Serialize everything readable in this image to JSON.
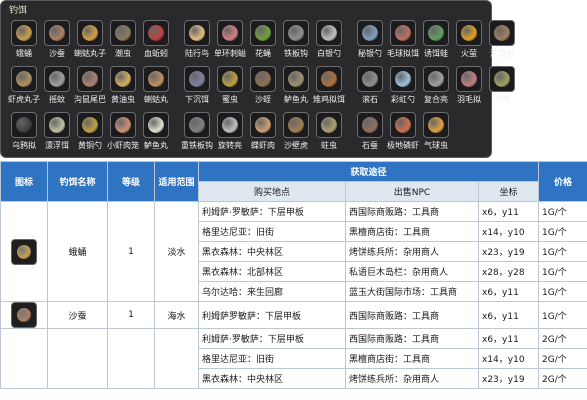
{
  "panel": {
    "title": "钓饵",
    "rows": [
      [
        {
          "label": "蛾蛹",
          "color": "#c8a050"
        },
        {
          "label": "沙蚕",
          "color": "#b08060"
        },
        {
          "label": "蝲蛄丸子",
          "color": "#d4a040"
        },
        {
          "label": "潮虫",
          "color": "#8a7a60"
        },
        {
          "label": "血蚯蚓",
          "color": "#c04040"
        },
        {
          "label": "陆行鸟",
          "color": "#e0c080"
        },
        {
          "label": "单环刺螠",
          "color": "#d08080"
        },
        {
          "label": "花蝇",
          "color": "#70a040"
        },
        {
          "label": "铁板钩",
          "color": "#909090"
        },
        {
          "label": "白银勺",
          "color": "#c0c0c0"
        },
        {
          "label": "秘银勺",
          "color": "#80a0c0"
        },
        {
          "label": "毛球拟饵",
          "color": "#c07060"
        },
        {
          "label": "诱饵蛙",
          "color": "#60a060"
        },
        {
          "label": "火萤",
          "color": "#e0a020"
        },
        {
          "label": "浮游虫",
          "color": "#a08060"
        }
      ],
      [
        {
          "label": "虾虎丸子",
          "color": "#b09060"
        },
        {
          "label": "摇蚊",
          "color": "#a0a0a0"
        },
        {
          "label": "沟鼠尾巴",
          "color": "#b08070"
        },
        {
          "label": "黄油虫",
          "color": "#d0b060"
        },
        {
          "label": "蝲蛄丸",
          "color": "#c09060"
        },
        {
          "label": "下沉饵",
          "color": "#8080a0"
        },
        {
          "label": "蜜虫",
          "color": "#c0a040"
        },
        {
          "label": "沙蛭",
          "color": "#907050"
        },
        {
          "label": "鲈鱼丸",
          "color": "#a09070"
        },
        {
          "label": "雉鸡拟饵",
          "color": "#b07040"
        },
        {
          "label": "滚石",
          "color": "#909090"
        },
        {
          "label": "彩虹勺",
          "color": "#a0c0e0"
        },
        {
          "label": "复合亮",
          "color": "#a0a0a0"
        },
        {
          "label": "羽毛拟",
          "color": "#c08080"
        },
        {
          "label": "弓角",
          "color": "#a0a060"
        }
      ],
      [
        {
          "label": "乌鸦拟",
          "color": "#404040"
        },
        {
          "label": "漂浮饵",
          "color": "#c0c0a0"
        },
        {
          "label": "黄铜勺",
          "color": "#c0a040"
        },
        {
          "label": "小虾肉笼",
          "color": "#d09070"
        },
        {
          "label": "鲈鱼丸",
          "color": "#e0e0d0"
        },
        {
          "label": "重铁板钩",
          "color": "#808080"
        },
        {
          "label": "旋转亮",
          "color": "#c0c0c0"
        },
        {
          "label": "蝶虾肉",
          "color": "#d0a070"
        },
        {
          "label": "沙壁虎",
          "color": "#a08050"
        },
        {
          "label": "蛀虫",
          "color": "#b0a070"
        },
        {
          "label": "石蚕",
          "color": "#907060"
        },
        {
          "label": "极地磷虾",
          "color": "#d07050"
        },
        {
          "label": "气球虫",
          "color": "#e0a040"
        }
      ]
    ]
  },
  "table": {
    "headers": {
      "icon": "图标",
      "name": "钓饵名称",
      "level": "等级",
      "scope": "适用范围",
      "source": "获取途径",
      "buy_place": "购买地点",
      "npc": "出售NPC",
      "coord": "坐标",
      "price": "价格"
    },
    "groups": [
      {
        "name": "蛾蛹",
        "level": "1",
        "scope": "淡水",
        "icon_color": "#c8a050",
        "rows": [
          {
            "place": "利姆萨·罗敏萨：下层甲板",
            "npc": "西国际商贩路：工具商",
            "coord": "x6，y11",
            "price": "1G/个"
          },
          {
            "place": "格里达尼亚：旧街",
            "npc": "黑檀商店街：工具商",
            "coord": "x14，y10",
            "price": "1G/个"
          },
          {
            "place": "黑衣森林：中央林区",
            "npc": "烤饼练兵所：杂用商人",
            "coord": "x23，y19",
            "price": "1G/个"
          },
          {
            "place": "黑衣森林：北部林区",
            "npc": "私语巨木岛栏：杂用商人",
            "coord": "x28，y28",
            "price": "1G/个"
          },
          {
            "place": "乌尔达哈：来生回廊",
            "npc": "蓝玉大街国际市场：工具商",
            "coord": "x6，y11",
            "price": "1G/个"
          }
        ]
      },
      {
        "name": "沙蚕",
        "level": "1",
        "scope": "海水",
        "icon_color": "#b08060",
        "rows": [
          {
            "place": "利姆萨罗敏萨：下层甲板",
            "npc": "西国际商贩路：工具商",
            "coord": "x6，y11",
            "price": "1G/个"
          }
        ]
      },
      {
        "name": "",
        "level": "",
        "scope": "",
        "rows": [
          {
            "place": "利姆萨·罗敏萨：下层甲板",
            "npc": "西国际商贩路：工具商",
            "coord": "x6，y11",
            "price": "2G/个"
          },
          {
            "place": "格里达尼亚：旧街",
            "npc": "黑檀商店街：工具商",
            "coord": "x14，y10",
            "price": "2G/个"
          },
          {
            "place": "黑衣森林：中央林区",
            "npc": "烤饼练兵所：杂用商人",
            "coord": "x23，y19",
            "price": "2G/个"
          }
        ]
      }
    ]
  }
}
